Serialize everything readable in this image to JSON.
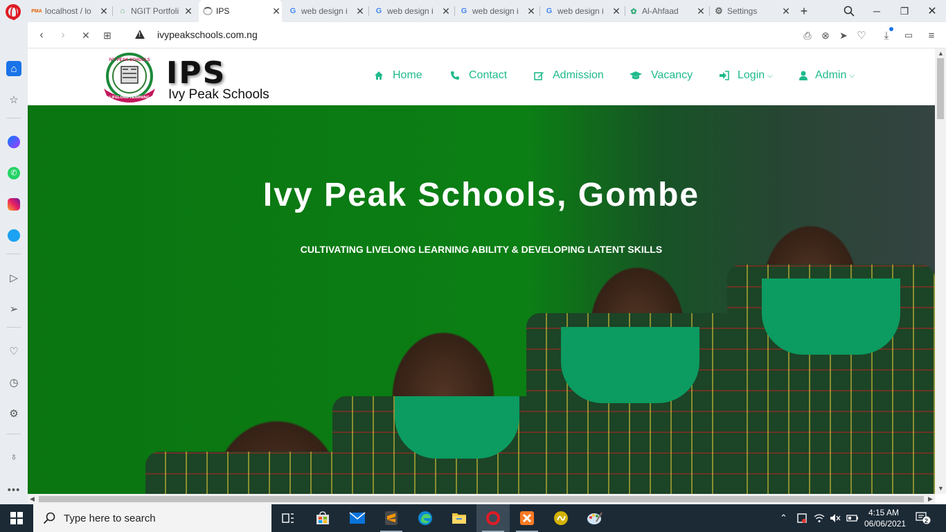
{
  "browser": {
    "tabs": [
      {
        "title": "localhost / lo",
        "favicon": "pma-icon",
        "active": false
      },
      {
        "title": "NGIT Portfoli",
        "favicon": "portfolio-icon",
        "active": false
      },
      {
        "title": "IPS",
        "favicon": "loading-spinner-icon",
        "active": true
      },
      {
        "title": "web design i",
        "favicon": "google-icon",
        "active": false
      },
      {
        "title": "web design i",
        "favicon": "google-icon",
        "active": false
      },
      {
        "title": "web design i",
        "favicon": "google-icon",
        "active": false
      },
      {
        "title": "web design i",
        "favicon": "google-icon",
        "active": false
      },
      {
        "title": "Al-Ahfaad",
        "favicon": "alahfaad-icon",
        "active": false
      },
      {
        "title": "Settings",
        "favicon": "gear-icon",
        "active": false
      }
    ],
    "favicon_labels": {
      "pma": "PMA",
      "google": "G"
    },
    "url": "ivypeakschools.com.ng"
  },
  "site": {
    "logo_text": "IPS",
    "logo_name": "Ivy Peak Schools",
    "crest_top": "IVY PEAK SCHOOLS",
    "crest_bottom": "LIFELONG LEARNING",
    "nav": [
      {
        "label": "Home",
        "icon": "home-icon",
        "dropdown": false
      },
      {
        "label": "Contact",
        "icon": "phone-icon",
        "dropdown": false
      },
      {
        "label": "Admission",
        "icon": "edit-icon",
        "dropdown": false
      },
      {
        "label": "Vacancy",
        "icon": "graduation-cap-icon",
        "dropdown": false
      },
      {
        "label": "Login",
        "icon": "sign-in-icon",
        "dropdown": true
      },
      {
        "label": "Admin",
        "icon": "user-icon",
        "dropdown": true
      }
    ],
    "accent_color": "#1fba8c",
    "hero": {
      "title": "Ivy Peak Schools, Gombe",
      "subtitle": "CULTIVATING LIVELONG LEARNING ABILITY & DEVELOPING LATENT SKILLS"
    }
  },
  "taskbar": {
    "search_placeholder": "Type here to search",
    "time": "4:15 AM",
    "date": "06/06/2021",
    "notification_count": "2"
  }
}
